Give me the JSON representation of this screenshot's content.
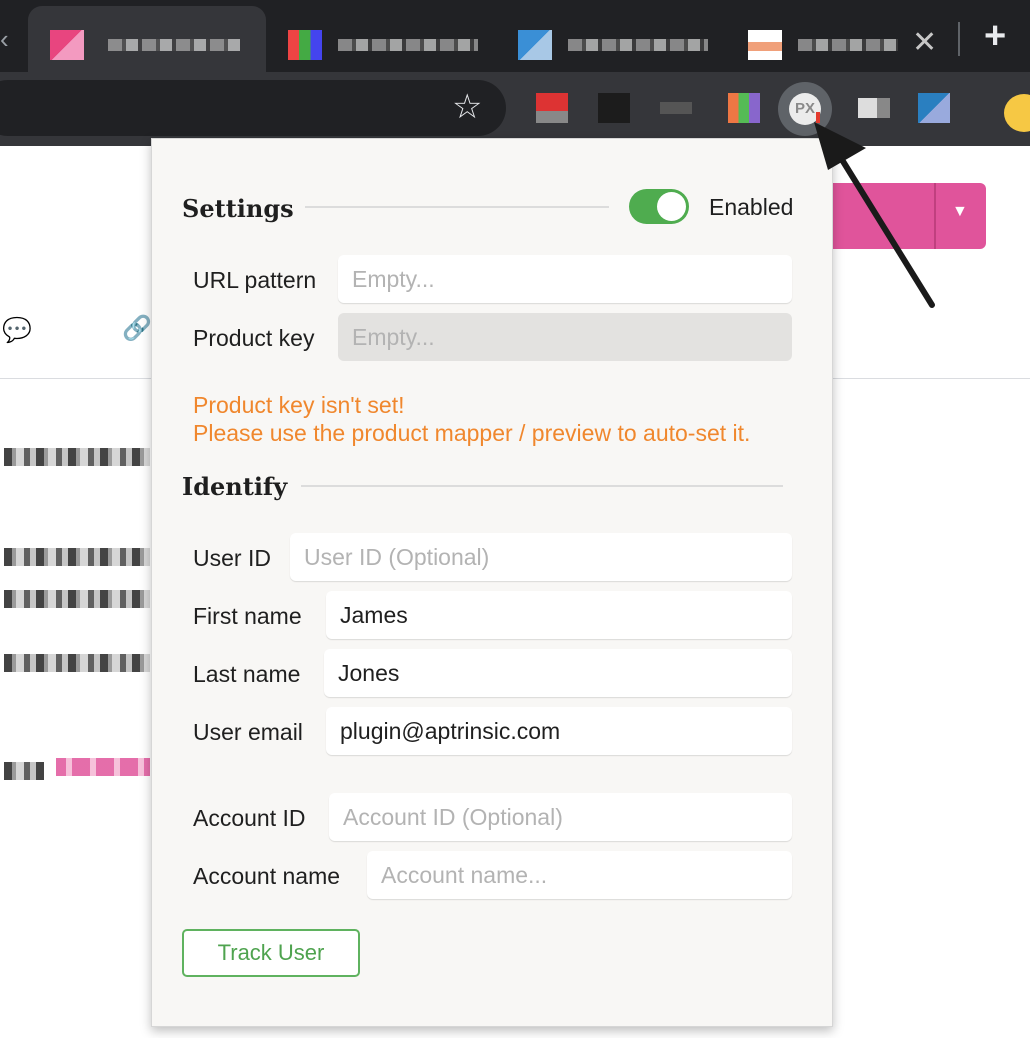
{
  "browser": {
    "new_tab_glyph": "+",
    "close_tab_glyph": "✕",
    "star_glyph": "☆",
    "extension_badge": "PX"
  },
  "popup": {
    "settings": {
      "title": "Settings",
      "toggle_label": "Enabled",
      "toggle_on": true,
      "url_pattern_label": "URL pattern",
      "url_pattern_value": "",
      "url_pattern_placeholder": "Empty...",
      "product_key_label": "Product key",
      "product_key_value": "",
      "product_key_placeholder": "Empty...",
      "warning_line1": "Product key isn't set!",
      "warning_line2": "Please use the product mapper / preview to auto-set it."
    },
    "identify": {
      "title": "Identify",
      "user_id_label": "User ID",
      "user_id_value": "",
      "user_id_placeholder": "User ID (Optional)",
      "first_name_label": "First name",
      "first_name_value": "James",
      "last_name_label": "Last name",
      "last_name_value": "Jones",
      "user_email_label": "User email",
      "user_email_value": "plugin@aptrinsic.com",
      "account_id_label": "Account ID",
      "account_id_value": "",
      "account_id_placeholder": "Account ID (Optional)",
      "account_name_label": "Account name",
      "account_name_value": "",
      "account_name_placeholder": "Account name...",
      "track_button": "Track User"
    }
  },
  "colors": {
    "accent_green": "#4fac4f",
    "warning_orange": "#f0872d",
    "page_pink": "#e0549b"
  }
}
